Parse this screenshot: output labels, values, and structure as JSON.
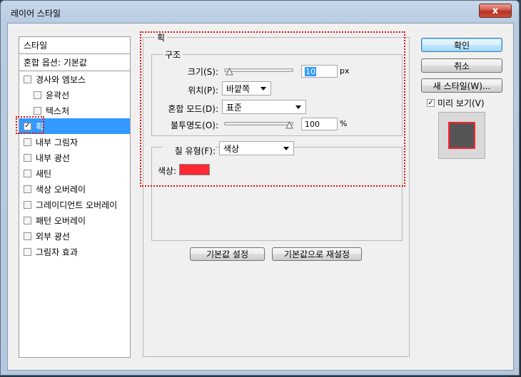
{
  "window": {
    "title": "레이어 스타일",
    "close_label": "x"
  },
  "style_list": {
    "header": "스타일",
    "blend_options": "혼합 옵션: 기본값",
    "items": [
      {
        "label": "경사와 엠보스",
        "checked": false
      },
      {
        "label": "윤곽선",
        "checked": false
      },
      {
        "label": "텍스처",
        "checked": false
      },
      {
        "label": "획",
        "checked": true
      },
      {
        "label": "내부 그림자",
        "checked": false
      },
      {
        "label": "내부 광선",
        "checked": false
      },
      {
        "label": "새틴",
        "checked": false
      },
      {
        "label": "색상 오버레이",
        "checked": false
      },
      {
        "label": "그레이디언트 오버레이",
        "checked": false
      },
      {
        "label": "패턴 오버레이",
        "checked": false
      },
      {
        "label": "외부 광선",
        "checked": false
      },
      {
        "label": "그림자 효과",
        "checked": false
      }
    ],
    "check_mark": "✓"
  },
  "stroke_panel": {
    "title": "획",
    "structure": {
      "title": "구조",
      "size_label": "크기(S):",
      "size_value": "10",
      "size_unit": "px",
      "size_slider_fraction": 0.02,
      "position_label": "위치(P):",
      "position_value": "바깥쪽",
      "blend_mode_label": "혼합 모드(D):",
      "blend_mode_value": "표준",
      "opacity_label": "불투명도(O):",
      "opacity_value": "100",
      "opacity_unit": "%",
      "opacity_slider_fraction": 1.0
    },
    "fill": {
      "fill_type_label": "칠 유형(F):",
      "fill_type_value": "색상",
      "color_label": "색상:",
      "color_hex": "#ff2833"
    },
    "make_default_label": "기본값 설정",
    "reset_default_label": "기본값으로 재설정"
  },
  "right_buttons": {
    "ok_label": "확인",
    "cancel_label": "취소",
    "new_style_label": "새 스타일(W)...",
    "preview_label": "미리 보기(V)",
    "preview_checked": true
  },
  "colors": {
    "selection": "#3399ff",
    "highlight_dash": "#e01010",
    "preview_fill": "#555555",
    "preview_stroke": "#ff2030"
  }
}
